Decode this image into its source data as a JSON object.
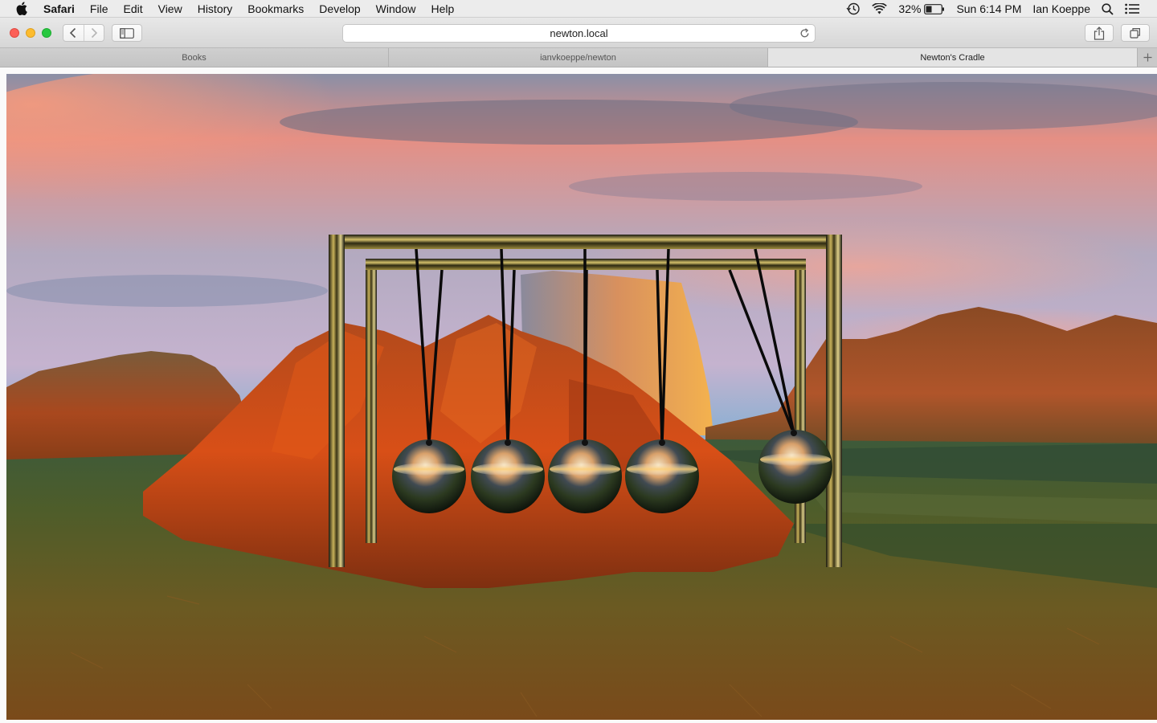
{
  "menubar": {
    "app_name": "Safari",
    "items": [
      "File",
      "Edit",
      "View",
      "History",
      "Bookmarks",
      "Develop",
      "Window",
      "Help"
    ],
    "battery_percent": "32%",
    "clock": "Sun 6:14 PM",
    "user_name": "Ian Koeppe"
  },
  "toolbar": {
    "address": "newton.local"
  },
  "tabs": [
    {
      "label": "Books",
      "active": false
    },
    {
      "label": "ianvkoeppe/newton",
      "active": false
    },
    {
      "label": "Newton's Cradle",
      "active": true
    }
  ],
  "scene": {
    "description_icon": "newtons-cradle-3d-scene",
    "balls_at_rest": 4,
    "balls_swung": 1
  }
}
